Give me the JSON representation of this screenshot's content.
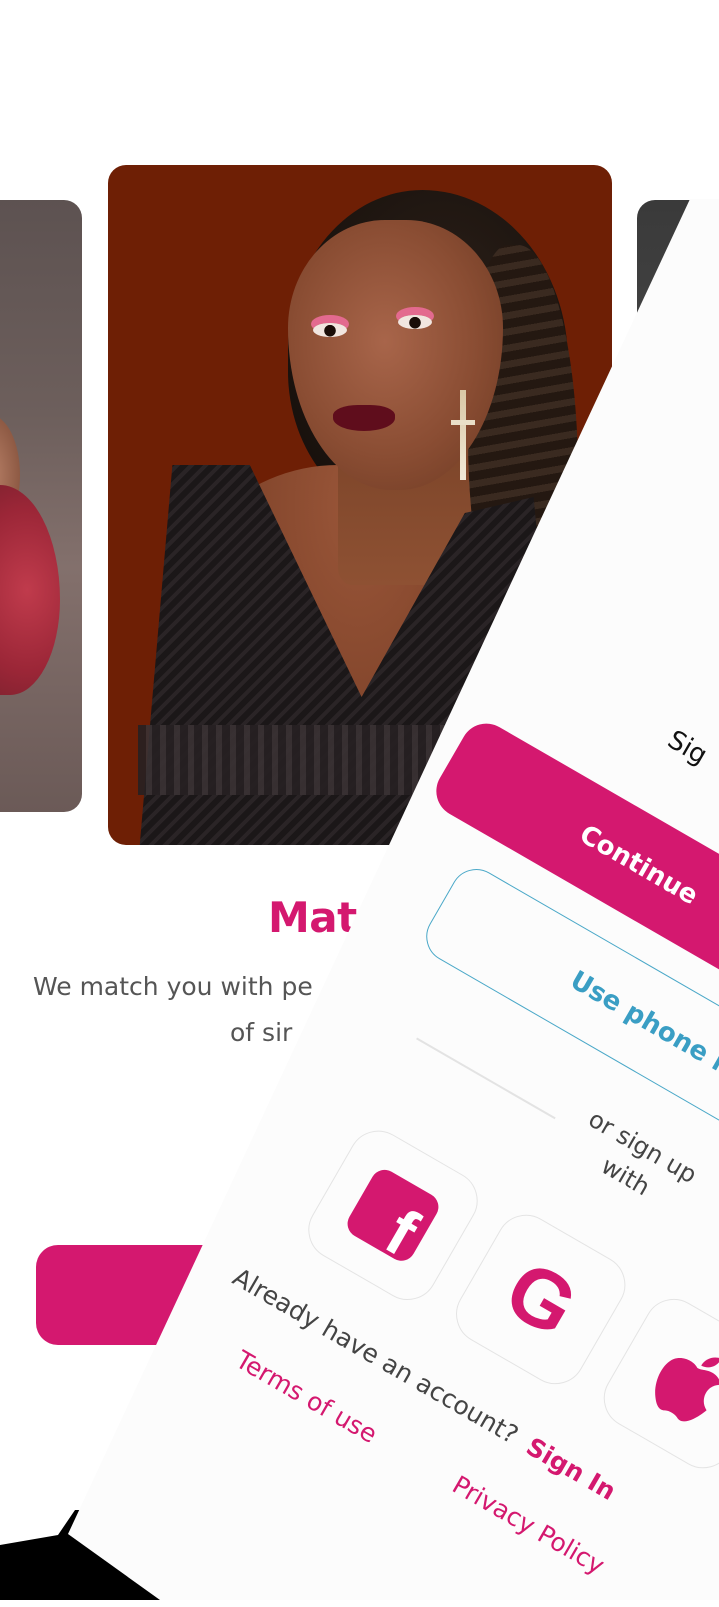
{
  "onboarding": {
    "title": "Mat",
    "description_line1": "We match you with pe",
    "description_line2": "of sir"
  },
  "signup_sheet": {
    "heading": "Sig",
    "continue_button": "Continue",
    "phone_button": "Use phone n",
    "or_line1": "or sign up",
    "or_line2": "with",
    "social": {
      "facebook_icon": "facebook-icon",
      "google_icon": "google-icon",
      "apple_icon": "apple-icon"
    },
    "already_text": "Already have an account?",
    "sign_in": "Sign In",
    "terms": "Terms of use",
    "privacy": "Privacy Policy"
  },
  "colors": {
    "brand": "#d4186f",
    "phone_accent": "#3a9ec4",
    "photo_bg": "#6e1f05"
  }
}
